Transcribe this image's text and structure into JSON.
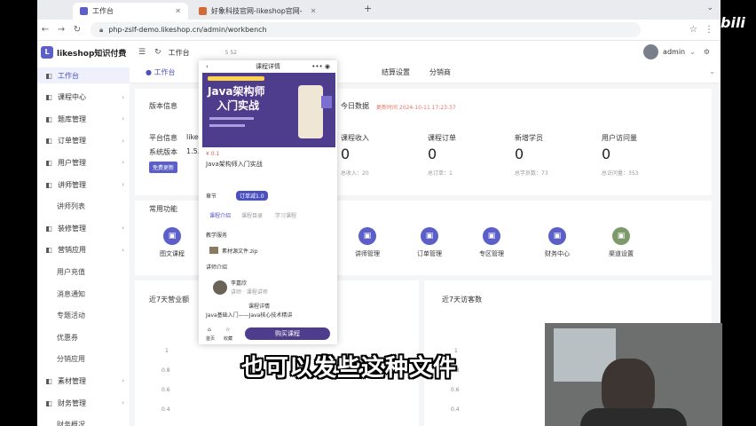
{
  "browser": {
    "tabs": [
      {
        "label": "工作台"
      },
      {
        "label": "好象科技官网-likeshop官网-"
      }
    ],
    "url": "php-zslf-demo.likeshop.cn/admin/workbench"
  },
  "app": {
    "logo_text": "likeshop知识付费",
    "topbar": {
      "crumb": "工作台",
      "user": "admin",
      "meta": "5 52"
    },
    "tags": [
      {
        "label": "● 工作台"
      },
      {
        "label": "结算设置"
      },
      {
        "label": "分销商"
      }
    ],
    "sidebar": [
      {
        "label": "工作台",
        "icon": "home-icon",
        "active": true
      },
      {
        "label": "课程中心",
        "icon": "book-icon",
        "arrow": true
      },
      {
        "label": "题库管理",
        "icon": "list-icon",
        "arrow": true
      },
      {
        "label": "订单管理",
        "icon": "order-icon",
        "arrow": true
      },
      {
        "label": "用户管理",
        "icon": "user-icon",
        "arrow": true
      },
      {
        "label": "讲师管理",
        "icon": "teacher-icon",
        "arrow": true
      },
      {
        "label": "讲师列表",
        "sub": true
      },
      {
        "label": "装修管理",
        "icon": "brush-icon",
        "arrow": true
      },
      {
        "label": "营销应用",
        "icon": "gift-icon",
        "arrow": true
      },
      {
        "label": "用户充值",
        "sub": true
      },
      {
        "label": "消息通知",
        "sub": true
      },
      {
        "label": "专题活动",
        "sub": true
      },
      {
        "label": "优惠券",
        "sub": true
      },
      {
        "label": "分销应用",
        "sub": true
      },
      {
        "label": "素材管理",
        "icon": "folder-icon",
        "arrow": true
      },
      {
        "label": "财务管理",
        "icon": "money-icon",
        "arrow": true
      },
      {
        "label": "财务概况",
        "sub": true
      }
    ],
    "version": {
      "title": "版本信息",
      "platform_label": "平台信息",
      "platform_value": "likeshop",
      "sys_label": "系统版本",
      "sys_value": "1.5.0",
      "free_btn": "免费更新"
    },
    "today": {
      "title": "今日数据",
      "update": "更新时间 2024-10-11 17:23:37",
      "stats": [
        {
          "label": "课程收入",
          "value": "0",
          "sub": "总收入：20"
        },
        {
          "label": "课程订单",
          "value": "0",
          "sub": "总订单：1"
        },
        {
          "label": "新增学员",
          "value": "0",
          "sub": "总学员数：73"
        },
        {
          "label": "用户访问量",
          "value": "0",
          "sub": "总访问量：353"
        }
      ]
    },
    "common": {
      "title": "常用功能",
      "items": [
        {
          "label": "图文课程",
          "icon": "image-icon",
          "color": "#5b5fc7"
        },
        {
          "label": "讲师管理",
          "icon": "teacher-icon",
          "color": "#5b5fc7"
        },
        {
          "label": "订单管理",
          "icon": "order-icon",
          "color": "#5b5fc7"
        },
        {
          "label": "专区管理",
          "icon": "zone-icon",
          "color": "#5b5fc7"
        },
        {
          "label": "财务中心",
          "icon": "money-icon",
          "color": "#5b5fc7"
        },
        {
          "label": "渠道设置",
          "icon": "channel-icon",
          "color": "#7d9a6a"
        }
      ]
    },
    "charts": {
      "sales_title": "近7天营业额",
      "visits_title": "近7天访客数",
      "yticks": [
        "1",
        "0.8",
        "0.6",
        "0.4"
      ]
    }
  },
  "phone": {
    "title": "课程详情",
    "cover_line1": "Java架构师",
    "cover_line2": "入门实战",
    "price": "¥ 0.1",
    "course_name": "Java架构师入门实战",
    "chapter_label": "章节",
    "pill": "订单减1.0",
    "tabs": [
      "课程介绍",
      "课程目录",
      "学习课程"
    ],
    "materials_title": "教学服务",
    "file_name": "素材源文件.zip",
    "teacher_title": "讲师介绍",
    "teacher_name": "李嘉欣",
    "teacher_sub": "讲师 · 课程讲师",
    "desc_title": "课程详情",
    "desc": "Java基础入门——Java核心技术精讲",
    "footer": [
      "首页",
      "收藏"
    ],
    "buy": "购买课程"
  },
  "caption": "也可以发些这种文件",
  "watermark": "bili"
}
